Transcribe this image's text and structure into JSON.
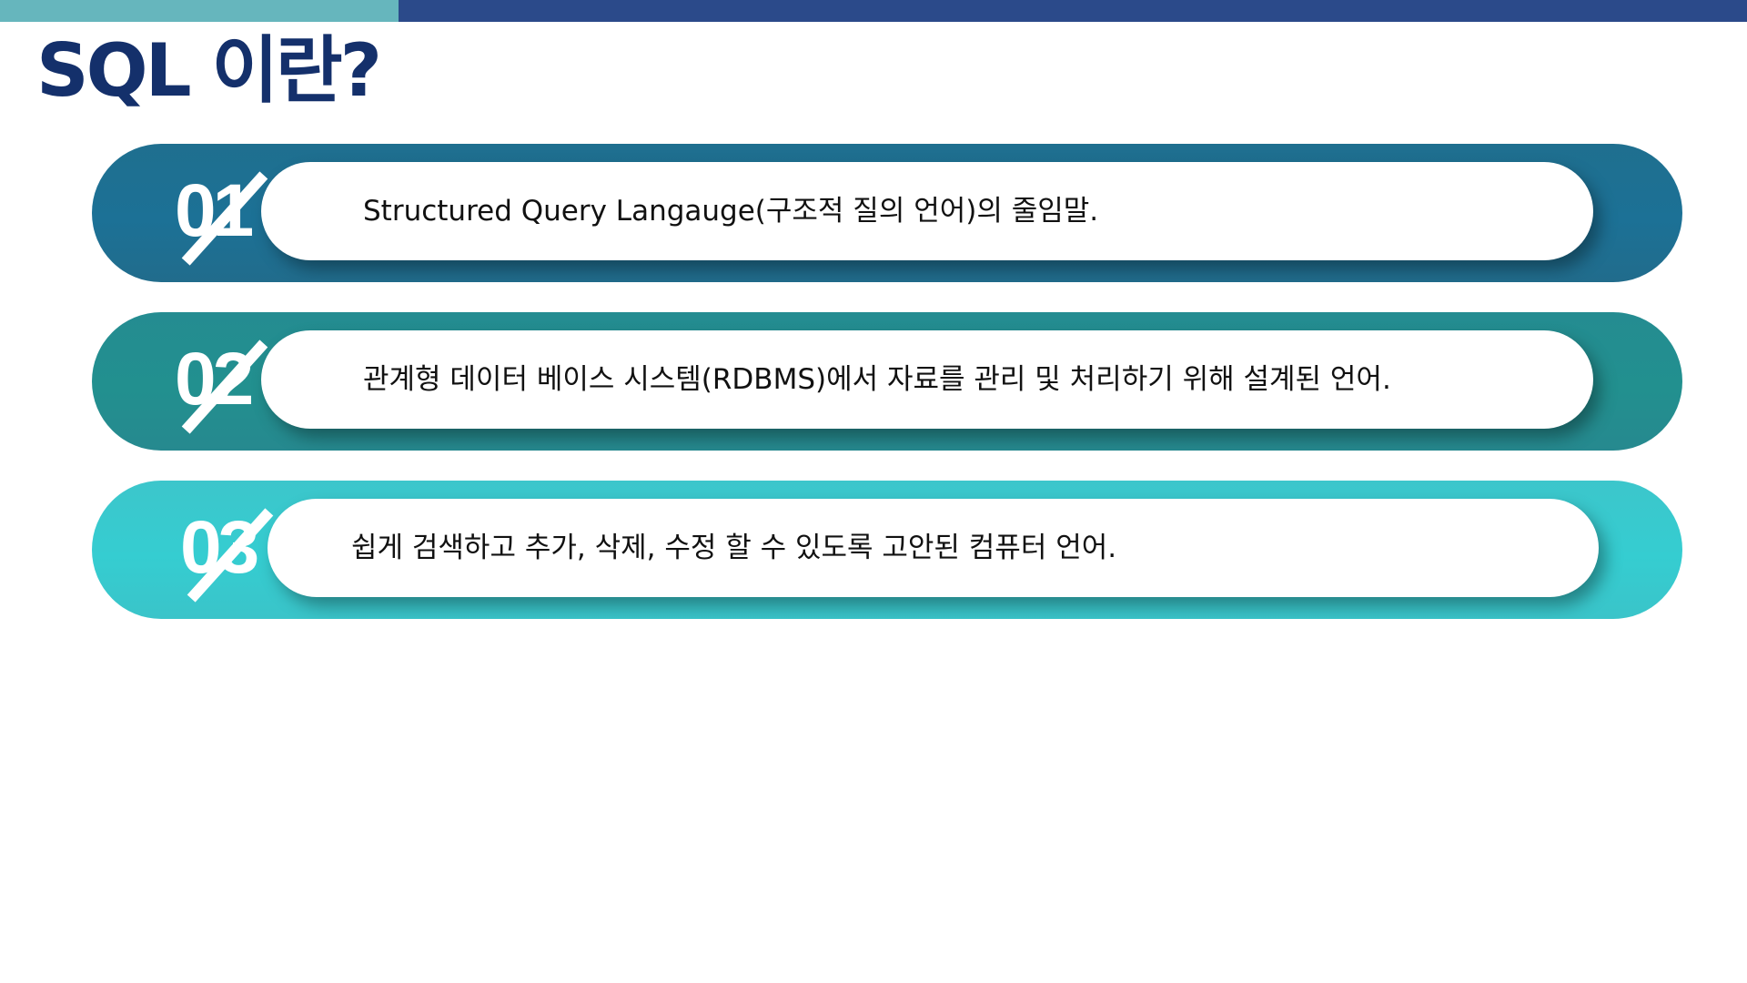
{
  "colors": {
    "top_bar_left": "#66b6bd",
    "top_bar_right": "#2b4a8a",
    "title": "#14306b",
    "item_1": "#1c7196",
    "item_2": "#22908f",
    "item_3": "#35cdd1"
  },
  "title": "SQL 이란?",
  "items": [
    {
      "number": "01",
      "text": "Structured Query Langauge(구조적 질의 언어)의 줄임말."
    },
    {
      "number": "02",
      "text": "관계형 데이터 베이스 시스템(RDBMS)에서 자료를 관리 및 처리하기 위해 설계된 언어."
    },
    {
      "number": "03",
      "text": "쉽게 검색하고 추가, 삭제, 수정 할 수 있도록 고안된 컴퓨터 언어."
    }
  ]
}
